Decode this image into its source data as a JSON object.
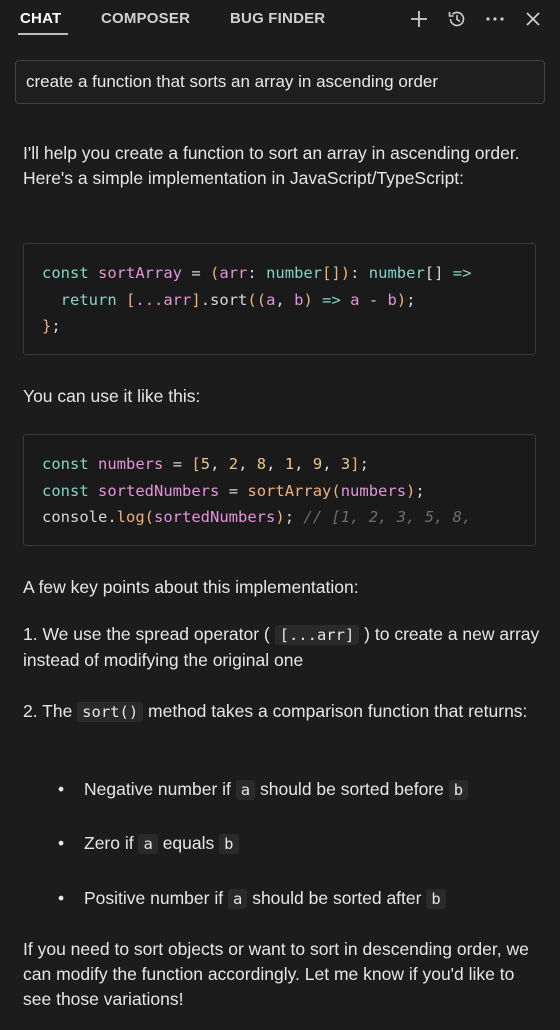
{
  "tabs": [
    {
      "label": "CHAT"
    },
    {
      "label": "COMPOSER"
    },
    {
      "label": "BUG FINDER"
    }
  ],
  "query": "create a function that sorts an array in ascending order",
  "response": {
    "intro": "I'll help you create a function to sort an array in ascending order. Here's a simple implementation in JavaScript/TypeScript:",
    "code1": {
      "line1": [
        "const",
        "sortArray",
        "=",
        "(",
        "arr",
        ":",
        "number",
        "[]",
        ")",
        ":",
        "number",
        "[]",
        "=>"
      ],
      "line2": [
        "return",
        "[",
        "...arr",
        "]",
        ".sort",
        "(",
        "(",
        "a",
        ",",
        "b",
        ")",
        "=>",
        "a",
        "-",
        "b",
        ")",
        ";"
      ],
      "line3": [
        "}",
        ";"
      ]
    },
    "usage_label": "You can use it like this:",
    "code2": {
      "line1": [
        "const",
        "numbers",
        "=",
        "[",
        "5",
        ",",
        "2",
        ",",
        "8",
        ",",
        "1",
        ",",
        "9",
        ",",
        "3",
        "]",
        ";"
      ],
      "line2": [
        "const",
        "sortedNumbers",
        "=",
        "sortArray",
        "(",
        "numbers",
        ")",
        ";"
      ],
      "line3": [
        "console",
        ".",
        "log",
        "(",
        "sortedNumbers",
        ")",
        ";",
        "// [1, 2, 3, 5, 8,"
      ]
    },
    "key_points_label": "A few key points about this implementation:",
    "point1": {
      "pre": "1. We use the spread operator (",
      "code": "[...arr]",
      "post": ") to create a new array instead of modifying the original one"
    },
    "point2": {
      "pre": "2. The",
      "code": "sort()",
      "post": "method takes a comparison function that returns:"
    },
    "bullets": [
      {
        "pre": "Negative number if",
        "a": "a",
        "mid": "should be sorted before",
        "b": "b"
      },
      {
        "pre": "Zero if",
        "a": "a",
        "mid": "equals",
        "b": "b"
      },
      {
        "pre": "Positive number if",
        "a": "a",
        "mid": "should be sorted after",
        "b": "b"
      }
    ],
    "outro": "If you need to sort objects or want to sort in descending order, we can modify the function accordingly. Let me know if you'd like to see those variations!"
  },
  "icons": [
    "plus-icon",
    "history-icon",
    "more-icon",
    "close-icon"
  ]
}
